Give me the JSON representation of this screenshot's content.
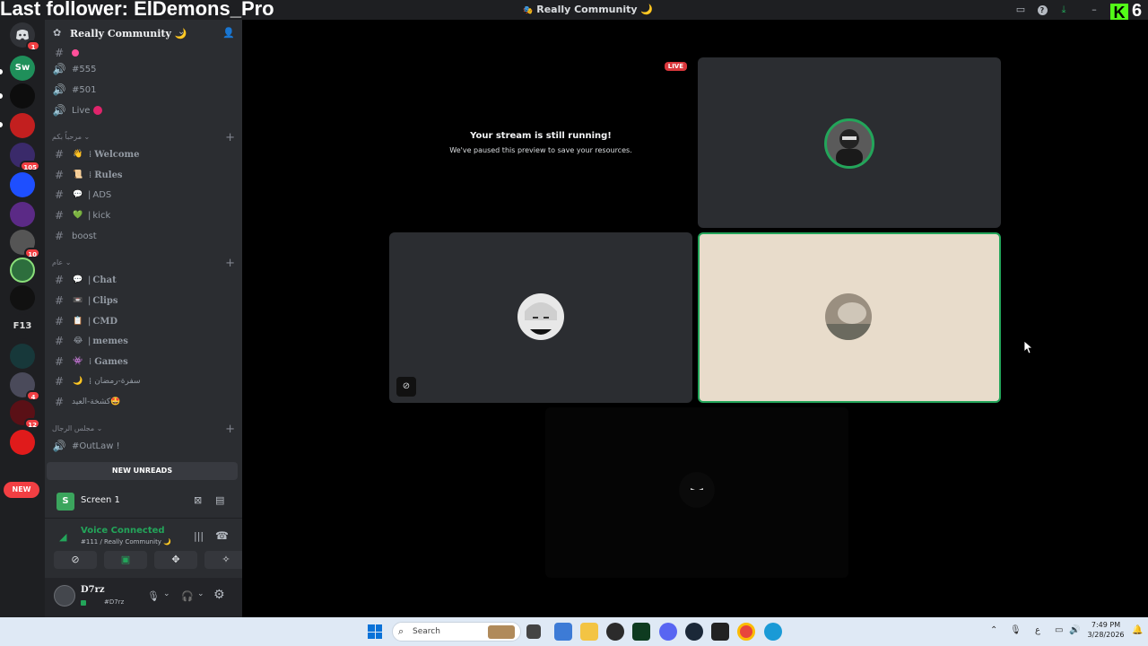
{
  "overlay": {
    "follower_text": "Last follower: ElDemons_Pro",
    "kick_count": "6"
  },
  "window": {
    "title": "Really Community 🌙"
  },
  "server": {
    "name": "Really Community 🌙"
  },
  "rail": {
    "badges": [
      "1",
      "105",
      "10",
      "4",
      "12"
    ],
    "new_label": "NEW"
  },
  "channels": {
    "voice_top": [
      {
        "name": "#555"
      },
      {
        "name": "#501"
      },
      {
        "name": "Live"
      }
    ],
    "category_1": "مرحباً بكم",
    "group_1": [
      {
        "emoji": "👋",
        "name": "Welcome"
      },
      {
        "emoji": "📜",
        "name": "Rules"
      },
      {
        "emoji": "💬",
        "name": "ADS"
      },
      {
        "emoji": "💚",
        "name": "kick"
      },
      {
        "emoji": "",
        "name": "boost"
      }
    ],
    "category_2": "عام",
    "group_2": [
      {
        "emoji": "💬",
        "name": "Chat"
      },
      {
        "emoji": "📼",
        "name": "Clips"
      },
      {
        "emoji": "📋",
        "name": "CMD"
      },
      {
        "emoji": "😂",
        "name": "memes"
      },
      {
        "emoji": "👾",
        "name": "Games"
      },
      {
        "emoji": "🌙",
        "name": "سفرة-رمضان"
      },
      {
        "emoji": "",
        "name": "كشخة-العيد🤩"
      }
    ],
    "category_3": "مجلس الرجال",
    "group_3": [
      {
        "name": "#OutLaw !"
      }
    ]
  },
  "new_unreads": "NEW UNREADS",
  "screen_panel": {
    "label": "Screen 1"
  },
  "voice": {
    "status": "Voice Connected",
    "channel": "#111 / Really Community 🌙"
  },
  "user": {
    "name": "D7rz",
    "tag": "#D7rz"
  },
  "stage": {
    "live_badge": "LIVE",
    "paused_title": "Your stream is still running!",
    "paused_sub": "We've paused this preview to save your resources."
  },
  "taskbar": {
    "search_placeholder": "Search",
    "time": "7:49 PM",
    "date": "3/28/2026"
  },
  "colors": {
    "accent_green": "#23a55a",
    "live_red": "#da373c",
    "kick_green": "#53fc18",
    "highlight_tile": "#e8dccb"
  }
}
